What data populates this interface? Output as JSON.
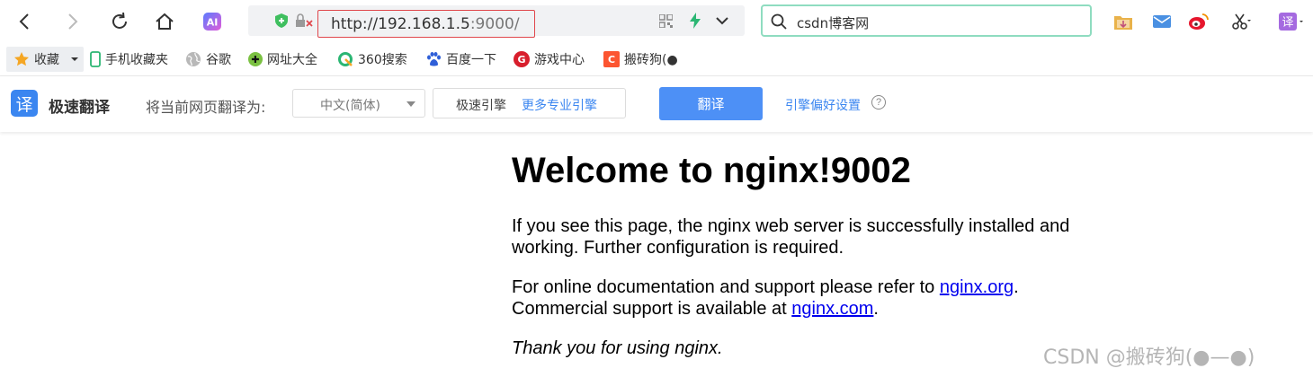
{
  "toolbar": {
    "url_host": "http://192.168.1.5",
    "url_port": ":9000/",
    "search_value": "csdn博客网"
  },
  "bookmarks": {
    "items": [
      {
        "label": "收藏"
      },
      {
        "label": "手机收藏夹"
      },
      {
        "label": "谷歌"
      },
      {
        "label": "网址大全"
      },
      {
        "label": "360搜索"
      },
      {
        "label": "百度一下"
      },
      {
        "label": "游戏中心"
      },
      {
        "label": "搬砖狗(●"
      }
    ]
  },
  "translate_bar": {
    "logo_char": "译",
    "title": "极速翻译",
    "label": "将当前网页翻译为:",
    "language": "中文(简体)",
    "engine": "极速引擎",
    "more_engines": "更多专业引擎",
    "translate_button": "翻译",
    "preferences": "引擎偏好设置",
    "help": "?"
  },
  "page": {
    "heading": "Welcome to nginx!9002",
    "p1": "If you see this page, the nginx web server is successfully installed and working. Further configuration is required.",
    "p2_prefix": "For online documentation and support please refer to ",
    "link_org": "nginx.org",
    "p2_mid": ".",
    "p2_line2_prefix": "Commercial support is available at ",
    "link_com": "nginx.com",
    "p2_end": ".",
    "p3": "Thank you for using nginx."
  },
  "watermark": "CSDN @搬砖狗(●—●)"
}
